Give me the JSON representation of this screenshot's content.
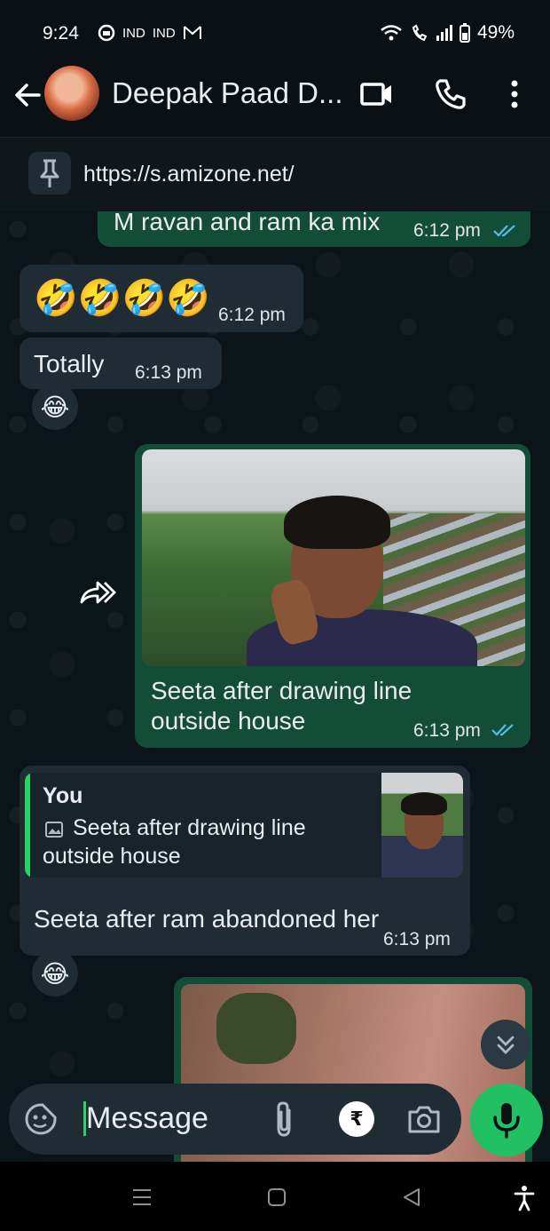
{
  "status_bar": {
    "time": "9:24",
    "carrier_icons": [
      "IND",
      "IND"
    ],
    "battery": "49%"
  },
  "header": {
    "contact_name": "Deepak Paad D...",
    "icons": [
      "back-arrow-icon",
      "video-call-icon",
      "phone-icon",
      "more-vert-icon"
    ]
  },
  "pinned": {
    "url": "https://s.amizone.net/"
  },
  "messages": [
    {
      "dir": "out",
      "text": "M ravan and ram ka mix",
      "time": "6:12 pm",
      "read": true
    },
    {
      "dir": "in",
      "text": "🤣🤣🤣🤣",
      "time": "6:12 pm"
    },
    {
      "dir": "in",
      "text": "Totally",
      "time": "6:13 pm",
      "reaction": "😂"
    },
    {
      "dir": "out",
      "type": "image",
      "caption_line1": "Seeta after drawing line",
      "caption_line2": "outside house",
      "time": "6:13 pm",
      "read": true,
      "forward_icon": "share-forward-icon"
    },
    {
      "dir": "in",
      "quote_author": "You",
      "quote_line1": "Seeta after drawing line",
      "quote_line2": "outside house",
      "text": "Seeta after ram abandoned her",
      "time": "6:13 pm",
      "reaction": "😂"
    }
  ],
  "composer": {
    "placeholder": "Message",
    "currency_symbol": "₹"
  },
  "colors": {
    "outgoing_bubble": "#144d37",
    "incoming_bubble": "#1f2c33",
    "accent": "#25d366",
    "read_ticks": "#53bdeb"
  }
}
